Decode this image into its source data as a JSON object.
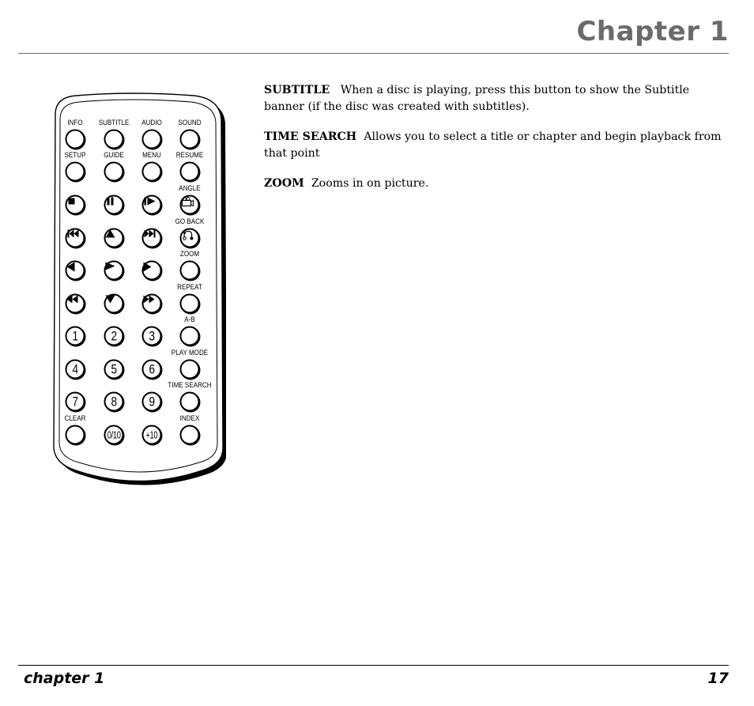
{
  "header": {
    "title": "Chapter 1"
  },
  "footer": {
    "left": "chapter 1",
    "page_number": "17"
  },
  "remote": {
    "buttons": [
      {
        "id": "info",
        "label": "INFO",
        "content": ""
      },
      {
        "id": "subtitle",
        "label": "SUBTITLE",
        "content": ""
      },
      {
        "id": "audio",
        "label": "AUDIO",
        "content": ""
      },
      {
        "id": "sound",
        "label": "SOUND",
        "content": ""
      },
      {
        "id": "setup",
        "label": "SETUP",
        "content": ""
      },
      {
        "id": "guide",
        "label": "GUIDE",
        "content": ""
      },
      {
        "id": "menu",
        "label": "MENU",
        "content": ""
      },
      {
        "id": "resume",
        "label": "RESUME",
        "content": ""
      },
      {
        "id": "stop",
        "label": "",
        "content": "",
        "icon": "stop-icon"
      },
      {
        "id": "pause",
        "label": "",
        "content": "",
        "icon": "pause-icon"
      },
      {
        "id": "step",
        "label": "",
        "content": "",
        "icon": "step-forward-icon"
      },
      {
        "id": "angle",
        "label": "ANGLE",
        "content": "",
        "icon": "camera-icon"
      },
      {
        "id": "prev",
        "label": "",
        "content": "",
        "icon": "skip-back-icon"
      },
      {
        "id": "up",
        "label": "",
        "content": "",
        "icon": "arrow-up-icon"
      },
      {
        "id": "next",
        "label": "",
        "content": "",
        "icon": "skip-forward-icon"
      },
      {
        "id": "goback",
        "label": "GO BACK",
        "content": "",
        "icon": "go-back-icon"
      },
      {
        "id": "left",
        "label": "",
        "content": "",
        "icon": "arrow-left-icon"
      },
      {
        "id": "play",
        "label": "",
        "content": "",
        "icon": "play-icon"
      },
      {
        "id": "right",
        "label": "",
        "content": "",
        "icon": "arrow-right-icon"
      },
      {
        "id": "zoom",
        "label": "ZOOM",
        "content": ""
      },
      {
        "id": "rewind",
        "label": "",
        "content": "",
        "icon": "rewind-icon"
      },
      {
        "id": "down",
        "label": "",
        "content": "",
        "icon": "arrow-down-icon"
      },
      {
        "id": "ffwd",
        "label": "",
        "content": "",
        "icon": "fast-forward-icon"
      },
      {
        "id": "repeat",
        "label": "REPEAT",
        "content": ""
      },
      {
        "id": "n1",
        "label": "",
        "content": "1"
      },
      {
        "id": "n2",
        "label": "",
        "content": "2"
      },
      {
        "id": "n3",
        "label": "",
        "content": "3"
      },
      {
        "id": "ab",
        "label": "A-B",
        "content": ""
      },
      {
        "id": "n4",
        "label": "",
        "content": "4"
      },
      {
        "id": "n5",
        "label": "",
        "content": "5"
      },
      {
        "id": "n6",
        "label": "",
        "content": "6"
      },
      {
        "id": "playmode",
        "label": "PLAY MODE",
        "content": ""
      },
      {
        "id": "n7",
        "label": "",
        "content": "7"
      },
      {
        "id": "n8",
        "label": "",
        "content": "8"
      },
      {
        "id": "n9",
        "label": "",
        "content": "9"
      },
      {
        "id": "timesearch",
        "label": "TIME SEARCH",
        "content": ""
      },
      {
        "id": "clear",
        "label": "CLEAR",
        "content": ""
      },
      {
        "id": "n010",
        "label": "",
        "content": "0/10"
      },
      {
        "id": "plus10",
        "label": "",
        "content": "+10"
      },
      {
        "id": "index",
        "label": "INDEX",
        "content": ""
      }
    ]
  },
  "descriptions": [
    {
      "term": "SUBTITLE",
      "text": "When a disc is playing, press this button to show the Subtitle banner (if the disc was created with subtitles)."
    },
    {
      "term": "TIME SEARCH",
      "text": "Allows you to select a title or chapter and begin playback from that point"
    },
    {
      "term": "ZOOM",
      "text": "Zooms in on picture."
    }
  ]
}
